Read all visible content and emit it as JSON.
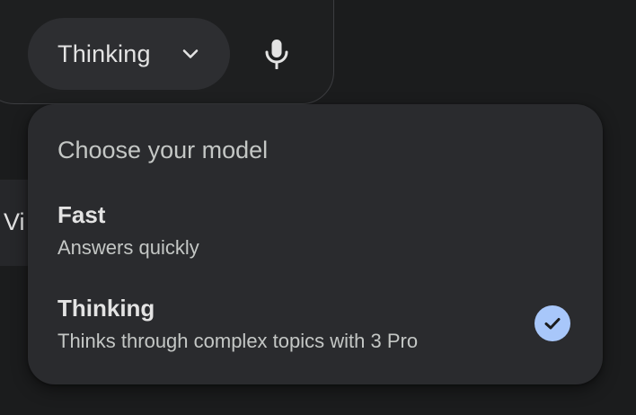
{
  "model_selector": {
    "current_label": "Thinking",
    "chevron_icon": "chevron-down-icon",
    "mic_icon": "microphone-icon"
  },
  "side_chip": {
    "label": "Vi"
  },
  "menu": {
    "title": "Choose your model",
    "options": [
      {
        "label": "Fast",
        "description": "Answers quickly",
        "selected": false
      },
      {
        "label": "Thinking",
        "description": "Thinks through complex topics with 3 Pro",
        "selected": true
      }
    ],
    "check_icon": "check-circle-icon"
  },
  "colors": {
    "background": "#1b1c1d",
    "surface": "#2a2b2e",
    "pill": "#2d2e31",
    "text_primary": "#e3e3e3",
    "text_secondary": "#c4c7c5",
    "accent": "#a8c7fa"
  }
}
